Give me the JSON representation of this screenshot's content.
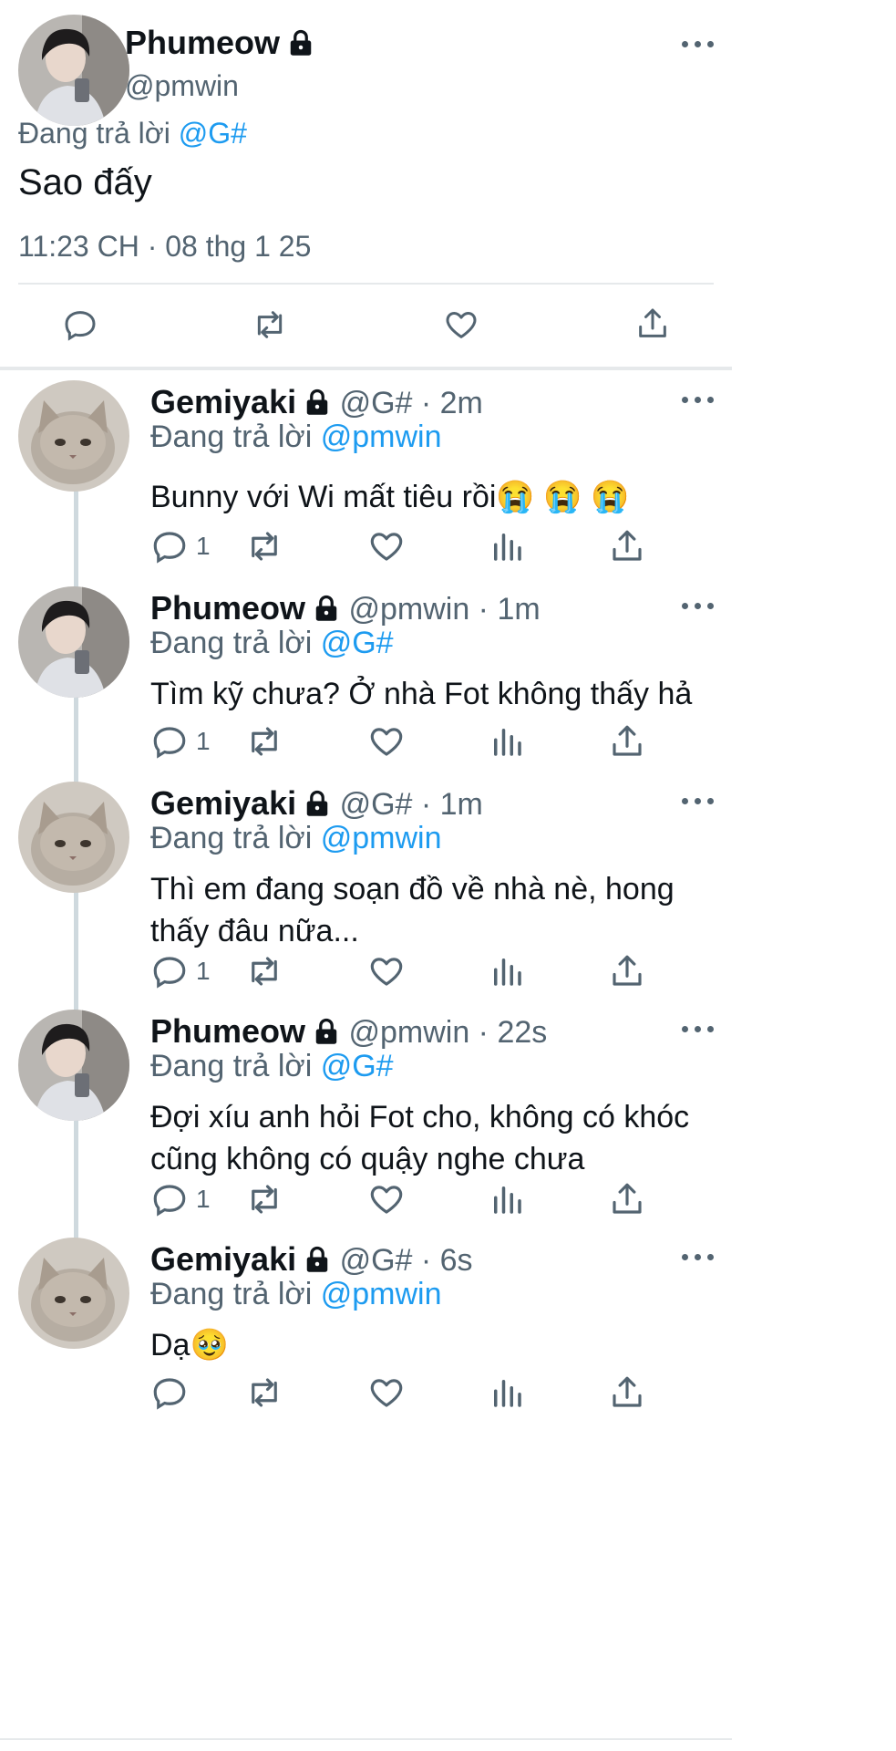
{
  "main_tweet": {
    "name": "Phumeow",
    "handle": "@pmwin",
    "replying_prefix": "Đang trả lời",
    "replying_to": "@G#",
    "text": "Sao đấy",
    "timestamp": "11:23 CH · 08 thg 1 25"
  },
  "replies": [
    {
      "name": "Gemiyaki",
      "handle": "@G#",
      "dot_time": " · 2m",
      "replying_prefix": "Đang trả lời",
      "replying_to": "@pmwin",
      "text": "Bunny với Wi mất tiêu rồi😭 😭 😭",
      "reply_count": "1",
      "avatar": "cat"
    },
    {
      "name": "Phumeow",
      "handle": "@pmwin",
      "dot_time": " · 1m",
      "replying_prefix": "Đang trả lời",
      "replying_to": "@G#",
      "text": "Tìm kỹ chưa? Ở nhà Fot không thấy hả",
      "reply_count": "1",
      "avatar": "person"
    },
    {
      "name": "Gemiyaki",
      "handle": "@G#",
      "dot_time": " · 1m",
      "replying_prefix": "Đang trả lời",
      "replying_to": "@pmwin",
      "text": "Thì em đang soạn đồ về nhà nè, hong thấy đâu nữa...",
      "reply_count": "1",
      "avatar": "cat"
    },
    {
      "name": "Phumeow",
      "handle": "@pmwin",
      "dot_time": " · 22s",
      "replying_prefix": "Đang trả lời",
      "replying_to": "@G#",
      "text": "Đợi xíu anh hỏi Fot cho, không có khóc cũng không có quậy nghe chưa",
      "reply_count": "1",
      "avatar": "person"
    },
    {
      "name": "Gemiyaki",
      "handle": "@G#",
      "dot_time": " · 6s",
      "replying_prefix": "Đang trả lời",
      "replying_to": "@pmwin",
      "text": "Dạ🥹",
      "reply_count": "",
      "avatar": "cat"
    }
  ],
  "icons": {
    "reply": "reply-icon",
    "retweet": "retweet-icon",
    "like": "like-icon",
    "views": "views-icon",
    "share": "share-icon",
    "lock": "lock-icon",
    "more": "more-icon"
  },
  "colors": {
    "accent": "#1d9bf0",
    "secondary_text": "#536471",
    "divider": "#e6e9eb"
  }
}
